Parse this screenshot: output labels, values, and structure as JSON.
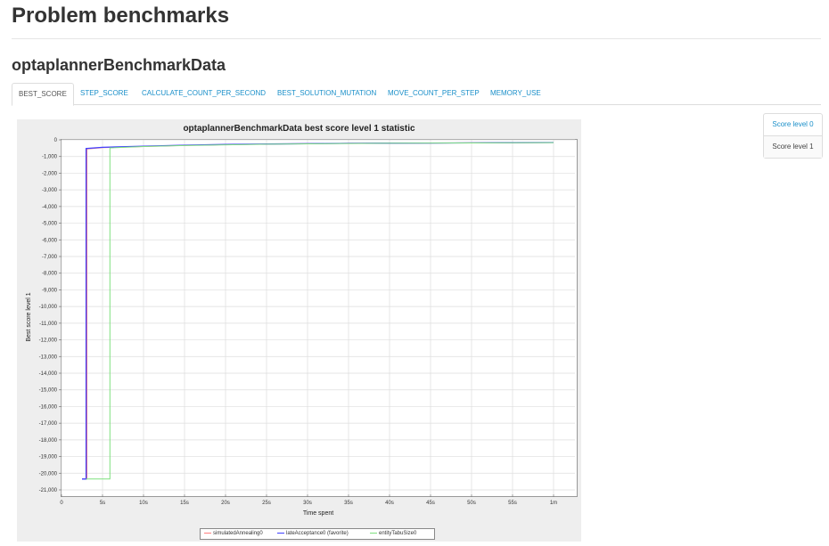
{
  "page_title": "Problem benchmarks",
  "section_title": "optaplannerBenchmarkData",
  "tabs": [
    {
      "label": "BEST_SCORE",
      "active": true
    },
    {
      "label": "STEP_SCORE",
      "active": false
    },
    {
      "label": "CALCULATE_COUNT_PER_SECOND",
      "active": false
    },
    {
      "label": "BEST_SOLUTION_MUTATION",
      "active": false
    },
    {
      "label": "MOVE_COUNT_PER_STEP",
      "active": false
    },
    {
      "label": "MEMORY_USE",
      "active": false
    }
  ],
  "side_nav": [
    {
      "label": "Score level 0",
      "selected": false
    },
    {
      "label": "Score level 1",
      "selected": true
    }
  ],
  "chart_data": {
    "type": "line",
    "title": "optaplannerBenchmarkData best score level 1 statistic",
    "xlabel": "Time spent",
    "ylabel": "Best score level 1",
    "xlim": [
      0,
      60
    ],
    "ylim": [
      -21000,
      0
    ],
    "x_ticks": [
      0,
      5,
      10,
      15,
      20,
      25,
      30,
      35,
      40,
      45,
      50,
      55,
      60
    ],
    "x_tick_labels": [
      "0",
      "5s",
      "10s",
      "15s",
      "20s",
      "25s",
      "30s",
      "35s",
      "40s",
      "45s",
      "50s",
      "55s",
      "1m"
    ],
    "y_ticks": [
      0,
      -1000,
      -2000,
      -3000,
      -4000,
      -5000,
      -6000,
      -7000,
      -8000,
      -9000,
      -10000,
      -11000,
      -12000,
      -13000,
      -14000,
      -15000,
      -16000,
      -17000,
      -18000,
      -19000,
      -20000,
      -21000
    ],
    "y_tick_labels": [
      "0",
      "-1,000",
      "-2,000",
      "-3,000",
      "-4,000",
      "-5,000",
      "-6,000",
      "-7,000",
      "-8,000",
      "-9,000",
      "-10,000",
      "-11,000",
      "-12,000",
      "-13,000",
      "-14,000",
      "-15,000",
      "-16,000",
      "-17,000",
      "-18,000",
      "-19,000",
      "-20,000",
      "-21,000"
    ],
    "grid": true,
    "legend_position": "bottom",
    "series": [
      {
        "name": "simulatedAnnealing0",
        "color": "#ff7f7f",
        "x": [
          2.5,
          3.1,
          3.1,
          5,
          10,
          15,
          20,
          25,
          30,
          35,
          40,
          45,
          50,
          55,
          60
        ],
        "y": [
          -20350,
          -20350,
          -550,
          -470,
          -400,
          -330,
          -290,
          -250,
          -230,
          -210,
          -200,
          -190,
          -180,
          -170,
          -160
        ]
      },
      {
        "name": "lateAcceptance0 (favorite)",
        "color": "#4040ff",
        "x": [
          2.5,
          3.0,
          3.0,
          5,
          10,
          15,
          20,
          25,
          30,
          35,
          40,
          45,
          50,
          55,
          60
        ],
        "y": [
          -20350,
          -20350,
          -520,
          -450,
          -380,
          -320,
          -280,
          -250,
          -230,
          -210,
          -200,
          -190,
          -180,
          -170,
          -160
        ]
      },
      {
        "name": "entityTabuSize0",
        "color": "#7fe07f",
        "x": [
          3.0,
          5.9,
          5.9,
          10,
          15,
          20,
          25,
          30,
          35,
          40,
          45,
          50,
          55,
          60
        ],
        "y": [
          -20350,
          -20350,
          -480,
          -400,
          -340,
          -300,
          -260,
          -240,
          -220,
          -205,
          -195,
          -185,
          -175,
          -165
        ]
      }
    ]
  }
}
